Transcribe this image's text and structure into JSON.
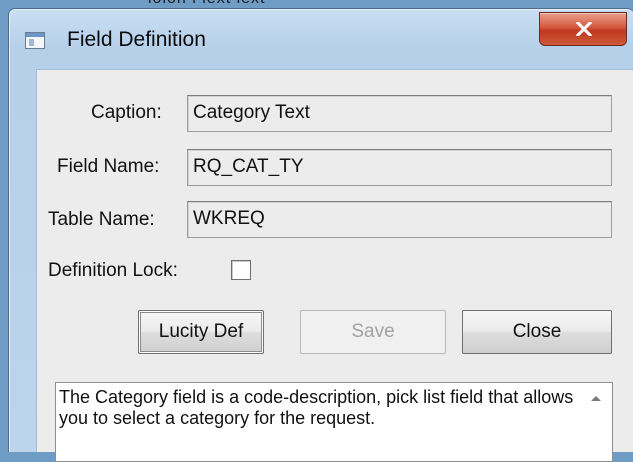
{
  "background": {
    "partial_text": "ioion i iext iext"
  },
  "window": {
    "title": "Field Definition",
    "title_icon": "app-window-icon",
    "close_icon": "close-icon",
    "colors": {
      "frame": "#b9d2ea",
      "close_button": "#c8462b",
      "client": "#ececec"
    }
  },
  "form": {
    "caption_label": "Caption:",
    "caption_value": "Category Text",
    "field_name_label": "Field Name:",
    "field_name_value": "RQ_CAT_TY",
    "table_name_label": "Table Name:",
    "table_name_value": "WKREQ",
    "definition_lock_label": "Definition Lock:",
    "definition_lock_checked": false
  },
  "buttons": {
    "lucity_def": "Lucity Def",
    "save": "Save",
    "close": "Close"
  },
  "description": {
    "text": "The Category field is a code-description, pick list field that allows you to select a category for the request.",
    "scroll_icon": "scroll-up-arrow-icon"
  }
}
